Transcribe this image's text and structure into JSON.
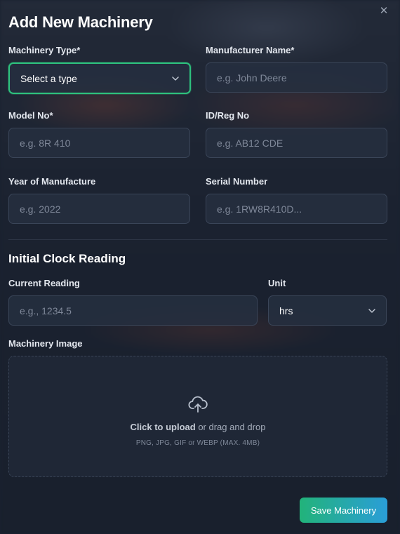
{
  "modal": {
    "title": "Add New Machinery",
    "close_icon": "close-icon"
  },
  "form": {
    "machinery_type": {
      "label": "Machinery Type*",
      "value": "Select a type"
    },
    "manufacturer": {
      "label": "Manufacturer Name*",
      "placeholder": "e.g. John Deere"
    },
    "model_no": {
      "label": "Model No*",
      "placeholder": "e.g. 8R 410"
    },
    "id_reg": {
      "label": "ID/Reg No",
      "placeholder": "e.g. AB12 CDE"
    },
    "year": {
      "label": "Year of Manufacture",
      "placeholder": "e.g. 2022"
    },
    "serial": {
      "label": "Serial Number",
      "placeholder": "e.g. 1RW8R410D..."
    }
  },
  "clock": {
    "heading": "Initial Clock Reading",
    "current_reading": {
      "label": "Current Reading",
      "placeholder": "e.g., 1234.5"
    },
    "unit": {
      "label": "Unit",
      "value": "hrs"
    }
  },
  "image": {
    "label": "Machinery Image",
    "upload_action": "Click to upload",
    "upload_rest": " or drag and drop",
    "hint": "PNG, JPG, GIF or WEBP (MAX. 4MB)",
    "icon": "upload-cloud-icon"
  },
  "actions": {
    "save_label": "Save Machinery"
  },
  "colors": {
    "accent_green": "#2ec27e",
    "button_gradient_start": "#22b37a",
    "button_gradient_end": "#2a9ed8",
    "background": "#1a2130"
  }
}
